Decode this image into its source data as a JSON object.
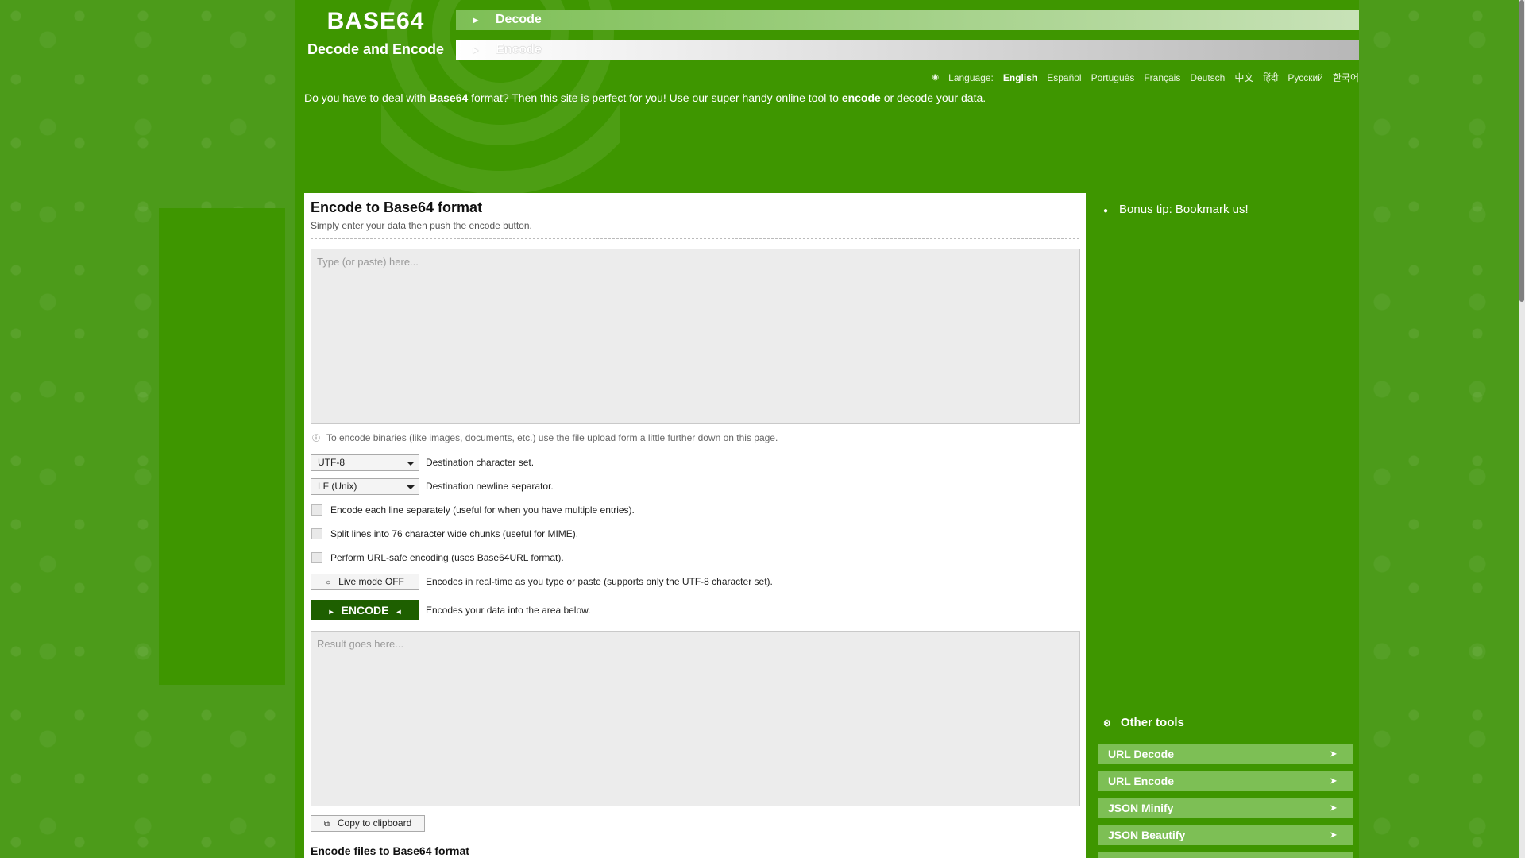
{
  "logo": {
    "title": "BASE64",
    "subtitle": "Decode and Encode"
  },
  "nav": {
    "decode": "Decode",
    "encode": "Encode"
  },
  "language": {
    "label": "Language:",
    "items": [
      "English",
      "Español",
      "Português",
      "Français",
      "Deutsch",
      "中文",
      "हिंदी",
      "Русский",
      "한국어"
    ]
  },
  "intro": {
    "p1": "Do you have to deal with ",
    "b1": "Base64",
    "p2": " format? Then this site is perfect for you! Use our super handy online tool to ",
    "b2": "encode",
    "p3": " or decode your data."
  },
  "main": {
    "title": "Encode to Base64 format",
    "subtitle": "Simply enter your data then push the encode button.",
    "input_placeholder": "Type (or paste) here...",
    "binary_note": "To encode binaries (like images, documents, etc.) use the file upload form a little further down on this page.",
    "charset_value": "UTF-8",
    "charset_label": "Destination character set.",
    "newline_value": "LF (Unix)",
    "newline_label": "Destination newline separator.",
    "opt_each_line": "Encode each line separately (useful for when you have multiple entries).",
    "opt_split": "Split lines into 76 character wide chunks (useful for MIME).",
    "opt_urlsafe": "Perform URL-safe encoding (uses Base64URL format).",
    "live_button": "Live mode OFF",
    "live_label": "Encodes in real-time as you type or paste (supports only the UTF-8 character set).",
    "encode_button": "ENCODE",
    "encode_label": "Encodes your data into the area below.",
    "output_placeholder": "Result goes here...",
    "copy_button": "Copy to clipboard",
    "files_title": "Encode files to Base64 format"
  },
  "side": {
    "tip": "Bonus tip: Bookmark us!",
    "other_title": "Other tools",
    "tools": [
      "URL Decode",
      "URL Encode",
      "JSON Minify",
      "JSON Beautify"
    ]
  },
  "icons": {
    "nav": "arrow-icon",
    "language": "globe-icon",
    "info": "info-icon",
    "live": "toggle-icon",
    "copy": "copy-icon",
    "tip": "bookmark-icon",
    "tools": "wrench-icon",
    "tool_arrow": "external-link-icon"
  },
  "colors": {
    "page_green": "#3e9600",
    "button_dark": "#1e5f00",
    "tool_green": "#7dbf55"
  }
}
